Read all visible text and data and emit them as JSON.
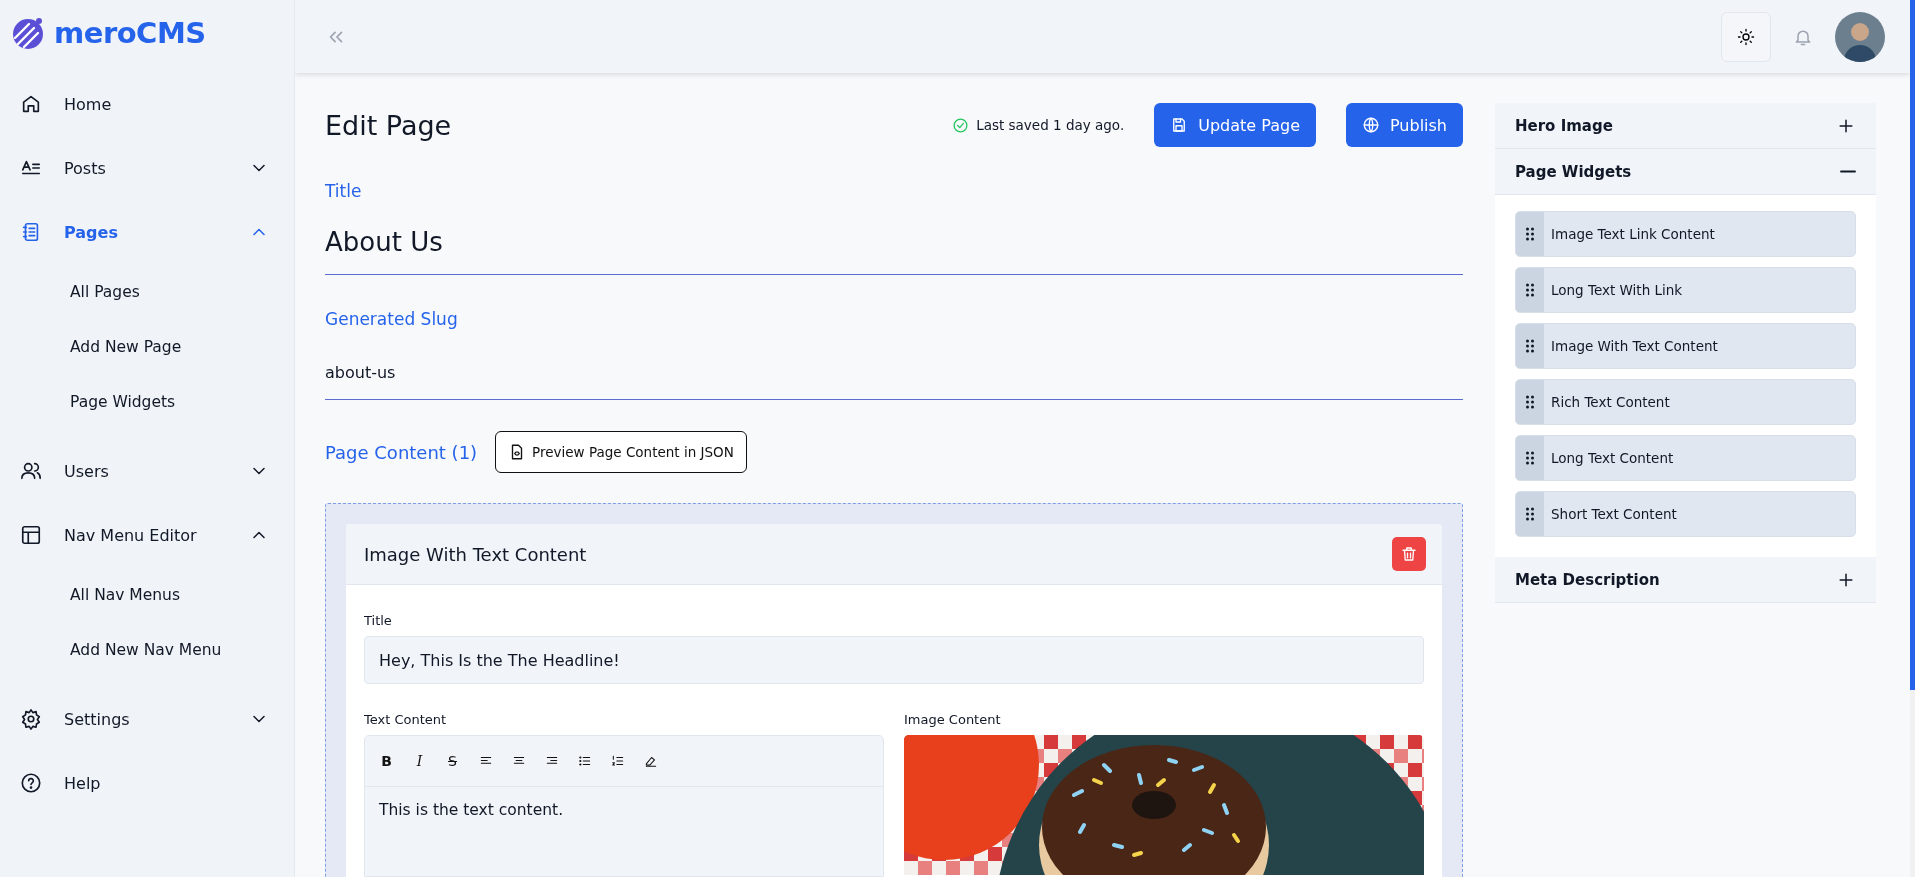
{
  "sidebar": {
    "logo": "meroCMS",
    "items": [
      {
        "label": "Home",
        "selected": false
      },
      {
        "label": "Posts",
        "selected": false,
        "expanded": false
      },
      {
        "label": "Pages",
        "selected": true,
        "expanded": true,
        "children": [
          {
            "label": "All Pages",
            "selected": false
          },
          {
            "label": "Add New Page",
            "selected": false
          },
          {
            "label": "Page Widgets",
            "selected": false
          }
        ]
      },
      {
        "label": "Users",
        "selected": false,
        "expanded": false
      },
      {
        "label": "Nav Menu Editor",
        "selected": false,
        "expanded": true,
        "children": [
          {
            "label": "All Nav Menus",
            "selected": false
          },
          {
            "label": "Add New Nav Menu",
            "selected": false
          }
        ]
      },
      {
        "label": "Settings",
        "selected": false,
        "expanded": false
      },
      {
        "label": "Help",
        "selected": false
      }
    ]
  },
  "header": {
    "title": "Edit Page",
    "status": "Last saved 1 day ago.",
    "buttons": [
      {
        "label": "Update Page",
        "kind": "save"
      },
      {
        "label": "Publish",
        "kind": "globe"
      }
    ]
  },
  "fields": [
    {
      "label": "Title",
      "value": "About Us",
      "kind": "heading"
    },
    {
      "label": "Generated Slug",
      "value": "about-us",
      "kind": "plain"
    }
  ],
  "page_content": {
    "label": "Page Content (1)",
    "preview_button": "Preview Page Content in JSON",
    "widgets": [
      {
        "title": "Image With Text Content",
        "title_label": "Title",
        "title_value": "Hey, This Is the The Headline!",
        "text_label": "Text Content",
        "text_value": "This is the text content.",
        "image_label": "Image Content",
        "toolbar": [
          {
            "kind": "bold",
            "label": "B"
          },
          {
            "kind": "italic",
            "label": "I"
          },
          {
            "kind": "strike",
            "label": "S"
          },
          {
            "kind": "align-left"
          },
          {
            "kind": "align-center"
          },
          {
            "kind": "align-right"
          },
          {
            "kind": "bullet-list"
          },
          {
            "kind": "ordered-list"
          },
          {
            "kind": "clear-format"
          }
        ]
      }
    ]
  },
  "right_panel": [
    {
      "title": "Hero Image",
      "expanded": false
    },
    {
      "title": "Page Widgets",
      "expanded": true,
      "items": [
        "Image Text Link Content",
        "Long Text With Link",
        "Image With Text Content",
        "Rich Text Content",
        "Long Text Content",
        "Short Text Content"
      ]
    },
    {
      "title": "Meta Description",
      "expanded": false
    }
  ]
}
